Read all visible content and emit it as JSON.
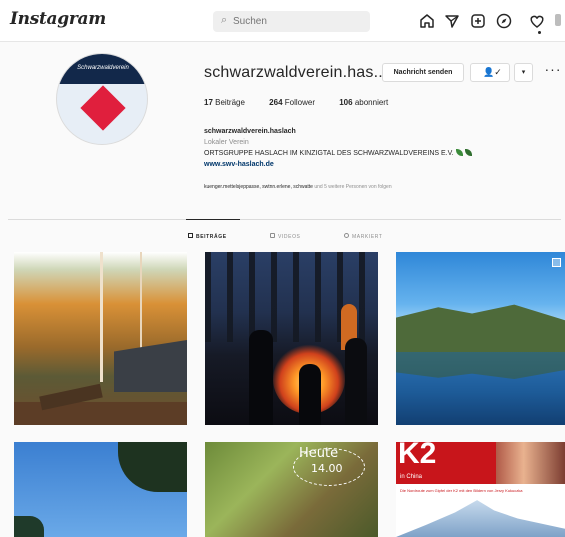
{
  "app": {
    "logo_text": "Instagram"
  },
  "topbar": {
    "search_placeholder": "Suchen",
    "icons": [
      "home-icon",
      "send-icon",
      "new-post-icon",
      "explore-icon",
      "activity-icon"
    ]
  },
  "profile": {
    "username": "schwarzwaldverein.has...",
    "message_button": "Nachricht senden",
    "stats": {
      "posts_count": "17",
      "posts_label": "Beiträge",
      "followers_count": "264",
      "followers_label": "Follower",
      "following_count": "106",
      "following_label": "abonniert"
    },
    "full_name": "schwarzwaldverein.haslach",
    "category": "Lokaler Verein",
    "description": "ORTSGRUPPE HASLACH IM KINZIGTAL DES SCHWARZWALDVEREINS E.V.",
    "website": "www.swv-haslach.de",
    "followed_by_names": "kuenger.mettelsjeppasse, swtnn.erlene, schwatte",
    "followed_by_more": "und 5 weitere Personen von folgen",
    "avatar_band_text": "Schwarzwaldverein"
  },
  "tabs": [
    {
      "label": "BEITRÄGE",
      "active": true
    },
    {
      "label": "VIDEOS",
      "active": false
    },
    {
      "label": "MARKIERT",
      "active": false
    }
  ],
  "posts": {
    "tile5_text_line1": "Heute",
    "tile5_text_line2": "14.00",
    "tile6_title": "K2",
    "tile6_subtitle": "in China",
    "tile6_caption": "Die Nordroute zum Gipfel der K2 mit den Bildern von Jerzy Kukuczka"
  },
  "colors": {
    "link": "#00376b",
    "accent_red": "#e01f3d",
    "avatar_band": "#12284a"
  }
}
